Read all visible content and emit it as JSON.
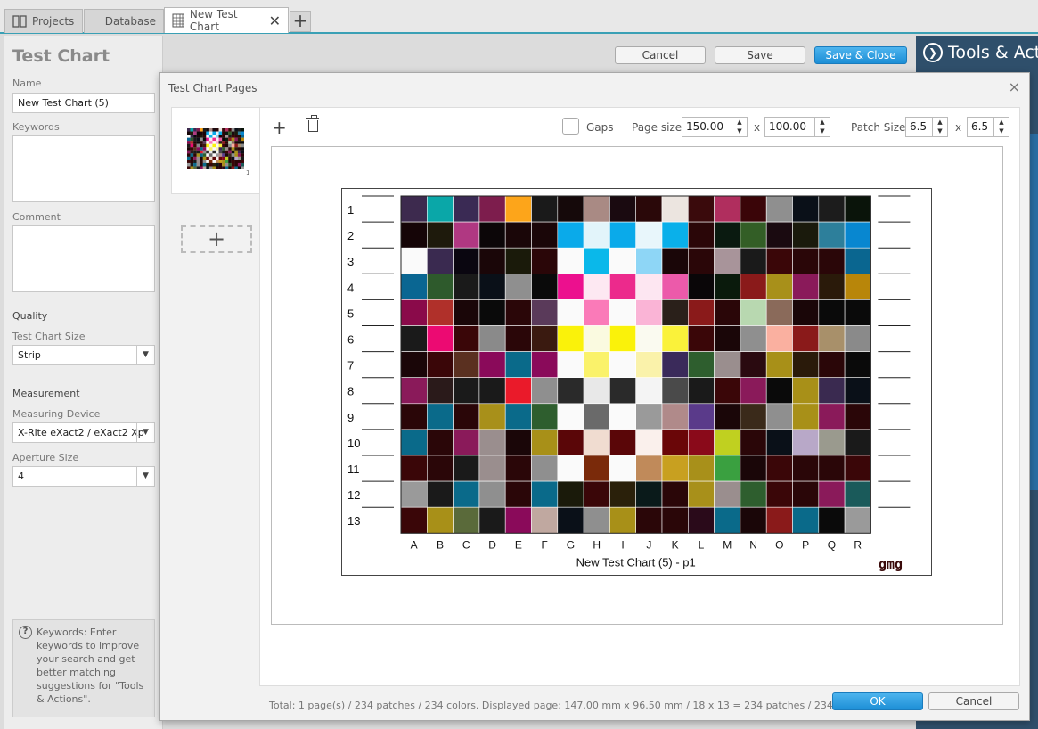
{
  "tabs": [
    {
      "label": "Projects",
      "icon": "projects-icon"
    },
    {
      "label": "Database",
      "icon": "database-icon"
    },
    {
      "label": "New Test Chart",
      "icon": "grid-chart-icon",
      "active": true
    }
  ],
  "page": {
    "title": "Test Chart"
  },
  "form": {
    "name_label": "Name",
    "name_value": "New Test Chart (5)",
    "keywords_label": "Keywords",
    "comment_label": "Comment",
    "quality_heading": "Quality",
    "size_label": "Test Chart Size",
    "size_value": "Strip",
    "measurement_heading": "Measurement",
    "device_label": "Measuring Device",
    "device_value": "X-Rite eXact2 / eXact2 Xp",
    "aperture_label": "Aperture Size",
    "aperture_value": "4"
  },
  "help": {
    "text": "Keywords: Enter keywords to improve your search and get better matching suggestions for \"Tools & Actions\"."
  },
  "actions": {
    "cancel": "Cancel",
    "save": "Save",
    "save_close": "Save & Close"
  },
  "tools": {
    "title": "Tools & Actions"
  },
  "dialog": {
    "title": "Test Chart Pages",
    "close": "×",
    "gaps_label": "Gaps",
    "page_size_label": "Page size",
    "page_w": "150.00",
    "page_h": "100.00",
    "times": "x",
    "patch_size_label": "Patch Size",
    "patch_w": "6.5",
    "patch_h": "6.5",
    "status": "Total: 1 page(s) / 234 patches / 234 colors. Displayed page: 147.00 mm x 96.50 mm / 18 x 13 = 234 patches / 234 colors",
    "ok": "OK",
    "cancel": "Cancel",
    "thumb_num": "1",
    "chart_caption": "New Test Chart (5) - p1",
    "logo": "gmg",
    "columns": [
      "A",
      "B",
      "C",
      "D",
      "E",
      "F",
      "G",
      "H",
      "I",
      "J",
      "K",
      "L",
      "M",
      "N",
      "O",
      "P",
      "Q",
      "R"
    ],
    "rows": [
      "1",
      "2",
      "3",
      "4",
      "5",
      "6",
      "7",
      "8",
      "9",
      "10",
      "11",
      "12",
      "13"
    ],
    "patch_colors": [
      [
        "#3d2a4e",
        "#0aa7a8",
        "#3a2a54",
        "#7d1d4d",
        "#fda51a",
        "#1a1a1a",
        "#15090a",
        "#a98a84",
        "#1a0a10",
        "#2a0809",
        "#ece5e0",
        "#3a0a0c",
        "#b02e5e",
        "#3a0508",
        "#8f8f8f",
        "#0a1018",
        "#1c1c1c",
        "#0a140a"
      ],
      [
        "#150507",
        "#1e1a0c",
        "#b03882",
        "#0c0608",
        "#1a0608",
        "#1a0608",
        "#0aaaea",
        "#e2f4fa",
        "#0aaaea",
        "#e8f6fb",
        "#0ab0ea",
        "#2a0608",
        "#0a1a10",
        "#335e26",
        "#1a0a10",
        "#1a1a0c",
        "#2d7f9b",
        "#0887d0"
      ],
      [
        "#fafafa",
        "#3a2a50",
        "#0a0610",
        "#1a0608",
        "#1a1a0a",
        "#2a0608",
        "#fafafa",
        "#0ab8ea",
        "#fafafa",
        "#8ed6f6",
        "#1a0608",
        "#2a0608",
        "#a8949a",
        "#1a1a1a",
        "#3a0608",
        "#2a0608",
        "#2a0608",
        "#0a6690"
      ],
      [
        "#0a6692",
        "#2e5a2c",
        "#1a1a1a",
        "#0a1018",
        "#8f8f8f",
        "#0a0a0a",
        "#ec108e",
        "#fde8f2",
        "#ec2a8c",
        "#fde6f1",
        "#ec5aaa",
        "#0a0608",
        "#0a1a0c",
        "#8a1a1a",
        "#a8901a",
        "#8a1a5a",
        "#2a1a0a",
        "#b8860a"
      ],
      [
        "#8a0a4a",
        "#b0302a",
        "#1a0608",
        "#0a0a0a",
        "#2a0608",
        "#5a3a5a",
        "#fafafa",
        "#fa7ab8",
        "#fafafa",
        "#fab4d6",
        "#2a201a",
        "#8a1a1a",
        "#2a0608",
        "#b8d8b0",
        "#8a6a5a",
        "#1a0608",
        "#0a0a0a",
        "#0a0a0a"
      ],
      [
        "#1a1a1a",
        "#ec0a72",
        "#3a0608",
        "#8a8a8a",
        "#2a0608",
        "#3a1a10",
        "#faf20a",
        "#fafae0",
        "#faf20a",
        "#fafaf0",
        "#faf23a",
        "#3a0608",
        "#1a0608",
        "#8f8f8f",
        "#fab0a0",
        "#8a1a1a",
        "#a8906a",
        "#8a8a8a"
      ],
      [
        "#1a0608",
        "#3a0608",
        "#5a3020",
        "#8a0a5a",
        "#0a6a8a",
        "#8a0a5a",
        "#fafafa",
        "#faf26a",
        "#fafafa",
        "#faf2aa",
        "#3a2a5a",
        "#2e5e2e",
        "#9a8e8e",
        "#2a0a10",
        "#a89018",
        "#2a1a0a",
        "#2a0608",
        "#0a0a0a"
      ],
      [
        "#8a1a5a",
        "#2a1a1a",
        "#1a1a1a",
        "#1a1a1a",
        "#ea1a2a",
        "#8f8f8f",
        "#2a2a2a",
        "#e8e8e8",
        "#2a2a2a",
        "#f4f4f4",
        "#4a4a4a",
        "#1a1a1a",
        "#3a0608",
        "#8a1a5a",
        "#0a0a0a",
        "#a89018",
        "#3a2a50",
        "#0a1018"
      ],
      [
        "#2a0608",
        "#0a6a8a",
        "#2a0608",
        "#a8901a",
        "#0a6a8a",
        "#2e5e2e",
        "#fafafa",
        "#6a6a6a",
        "#fafafa",
        "#9a9a9a",
        "#b08a8a",
        "#5a3a8a",
        "#1a0608",
        "#3a2a1a",
        "#8f8f8f",
        "#a89018",
        "#8a1a5a",
        "#2a0608"
      ],
      [
        "#0a6a8a",
        "#2a0608",
        "#8a1a5a",
        "#9a8e8e",
        "#1a0608",
        "#a89018",
        "#5a0608",
        "#f0dcd0",
        "#5a0608",
        "#faf0ec",
        "#6a0608",
        "#8a0a1a",
        "#c0d020",
        "#2a0608",
        "#0a1018",
        "#b8a8c8",
        "#9a9a8e",
        "#1a1a1a"
      ],
      [
        "#3a0608",
        "#2a0608",
        "#1a1a1a",
        "#9a8e8e",
        "#2a0608",
        "#8f8f8f",
        "#fafafa",
        "#7a2a0a",
        "#fafafa",
        "#c08a5a",
        "#c8a020",
        "#a8901a",
        "#3aa040",
        "#1a0608",
        "#3a0608",
        "#2a0608",
        "#2a0608",
        "#3a0608"
      ],
      [
        "#9a9a9a",
        "#1a1a1a",
        "#0a6a8a",
        "#8f8f8f",
        "#2a0608",
        "#0a6a8a",
        "#1a1a0a",
        "#3a0608",
        "#2a200a",
        "#0a1a1a",
        "#2a0608",
        "#a8901a",
        "#9a8e8e",
        "#2e5e2e",
        "#3a0608",
        "#2a0608",
        "#8a1a5a",
        "#1a5a5a"
      ],
      [
        "#3a0608",
        "#a89018",
        "#5a6a3a",
        "#1a1a1a",
        "#8a0a5a",
        "#c0a8a0",
        "#0a1018",
        "#8f8f8f",
        "#a89018",
        "#2a0608",
        "#2a0608",
        "#2a0a1a",
        "#0a6a8a",
        "#1a0608",
        "#8a1a1a",
        "#0a6a8a",
        "#0a0a0a",
        "#9a9a9a"
      ]
    ]
  }
}
